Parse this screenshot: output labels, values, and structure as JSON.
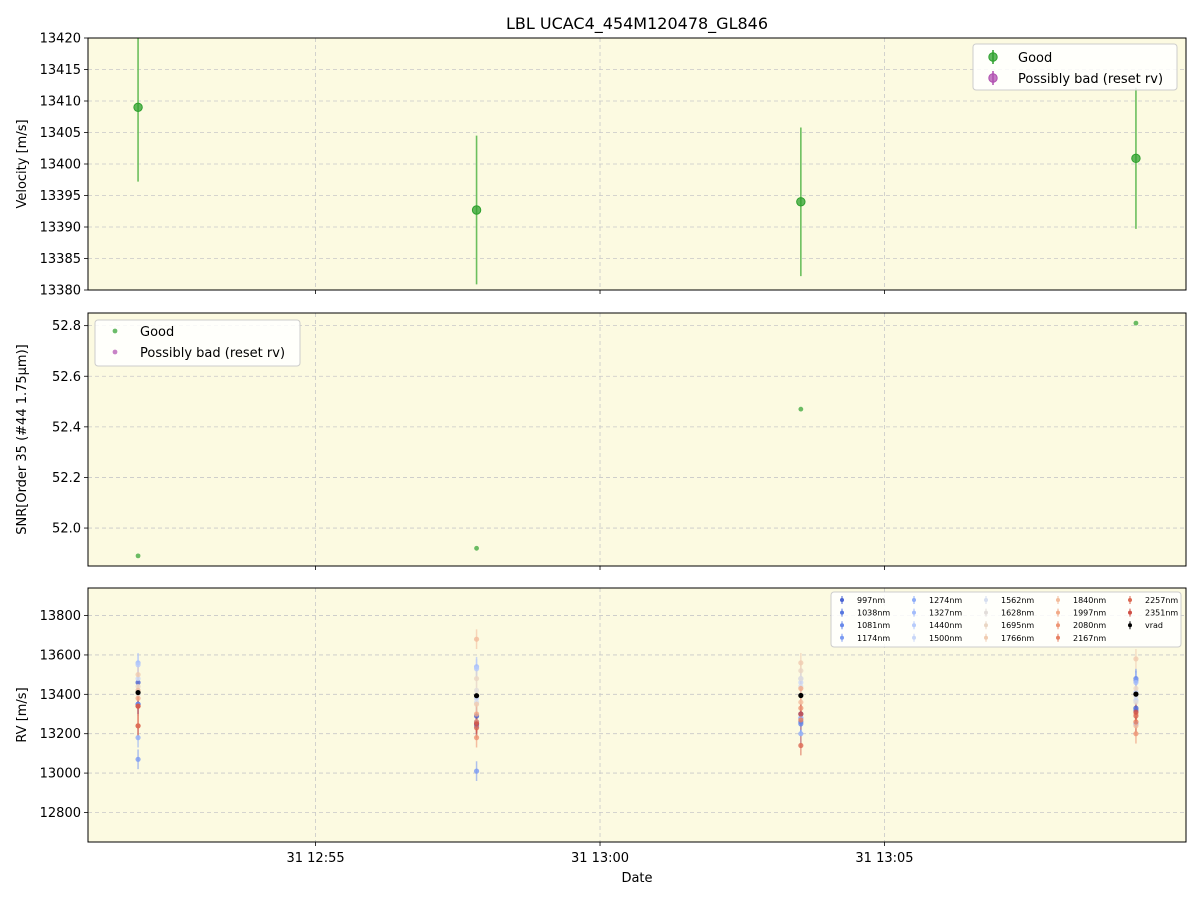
{
  "title": "LBL UCAC4_454M120478_GL846",
  "xlabel": "Date",
  "x_ticks": [
    "31 12:55",
    "31 13:00",
    "31 13:05"
  ],
  "x_tick_minutes": [
    55,
    60,
    65
  ],
  "x_range_minutes": [
    51.0,
    70.3
  ],
  "colors": {
    "plot_bg": "#fcfae1",
    "good": "#2ca02c",
    "good_err": "#6cbf5e",
    "bad": "#b04fb0",
    "grid": "#c8c8c8",
    "vrad": "#000000"
  },
  "chart_data": [
    {
      "type": "scatter",
      "ylabel": "Velocity [m/s]",
      "ylim": [
        13380,
        13420
      ],
      "y_ticks": [
        13380,
        13385,
        13390,
        13395,
        13400,
        13405,
        13410,
        13415,
        13420
      ],
      "legend": [
        "Good",
        "Possibly bad (reset rv)"
      ],
      "legend_loc": "upper right",
      "grid": true,
      "series": [
        {
          "name": "Good",
          "x_minutes": [
            51.88,
            57.83,
            63.53,
            69.42
          ],
          "y": [
            13409.0,
            13392.7,
            13394.0,
            13400.9
          ],
          "yerr": [
            11.8,
            11.8,
            11.8,
            11.2
          ]
        },
        {
          "name": "Possibly bad (reset rv)",
          "x_minutes": [],
          "y": [],
          "yerr": []
        }
      ]
    },
    {
      "type": "scatter",
      "ylabel": "SNR[Order 35 (#44 1.75μm)]",
      "ylim": [
        51.85,
        52.85
      ],
      "y_ticks": [
        52.0,
        52.2,
        52.4,
        52.6,
        52.8
      ],
      "y_tick_labels": [
        "52.0",
        "52.2",
        "52.4",
        "52.6",
        "52.8"
      ],
      "legend": [
        "Good",
        "Possibly bad (reset rv)"
      ],
      "legend_loc": "upper left",
      "grid": true,
      "series": [
        {
          "name": "Good",
          "x_minutes": [
            51.88,
            57.83,
            63.53,
            69.42
          ],
          "y": [
            51.89,
            51.92,
            52.47,
            52.81
          ]
        },
        {
          "name": "Possibly bad (reset rv)",
          "x_minutes": [],
          "y": []
        }
      ]
    },
    {
      "type": "scatter",
      "ylabel": "RV [m/s]",
      "ylim": [
        12650,
        13940
      ],
      "y_ticks": [
        12800,
        13000,
        13200,
        13400,
        13600,
        13800
      ],
      "legend_loc": "upper right",
      "legend_columns": 5,
      "grid": true,
      "x_minutes": [
        51.88,
        57.83,
        63.53,
        69.42
      ],
      "series": [
        {
          "name": "997nm",
          "color": "#4a63d3",
          "y": [
            13460,
            13290,
            13300,
            13330
          ]
        },
        {
          "name": "1038nm",
          "color": "#5677e0",
          "y": [
            13350,
            13250,
            13260,
            13320
          ]
        },
        {
          "name": "1081nm",
          "color": "#6788ea",
          "y": [
            13350,
            13240,
            13250,
            13480
          ]
        },
        {
          "name": "1174nm",
          "color": "#7a9af2",
          "y": [
            13070,
            13010,
            13280,
            13470
          ]
        },
        {
          "name": "1274nm",
          "color": "#8eacf8",
          "y": [
            13180,
            13260,
            13200,
            13250
          ]
        },
        {
          "name": "1327nm",
          "color": "#a3bcfb",
          "y": [
            13560,
            13540,
            13280,
            13460
          ]
        },
        {
          "name": "1440nm",
          "color": "#b7cbfb",
          "y": [
            13550,
            13530,
            13480,
            13410
          ]
        },
        {
          "name": "1500nm",
          "color": "#c8d6f8",
          "y": [
            13480,
            13380,
            13460,
            13370
          ]
        },
        {
          "name": "1562nm",
          "color": "#d6deef",
          "y": [
            13420,
            13360,
            13440,
            13390
          ]
        },
        {
          "name": "1628nm",
          "color": "#e2ddda",
          "y": [
            13400,
            13420,
            13480,
            13360
          ]
        },
        {
          "name": "1695nm",
          "color": "#ead6c4",
          "y": [
            13440,
            13480,
            13520,
            13430
          ]
        },
        {
          "name": "1766nm",
          "color": "#f0cbb0",
          "y": [
            13500,
            13350,
            13560,
            13580
          ]
        },
        {
          "name": "1840nm",
          "color": "#f3bc9c",
          "y": [
            13420,
            13680,
            13360,
            13240
          ]
        },
        {
          "name": "1997nm",
          "color": "#f2aa88",
          "y": [
            13380,
            13300,
            13430,
            13300
          ]
        },
        {
          "name": "2080nm",
          "color": "#ee9574",
          "y": [
            13340,
            13180,
            13330,
            13200
          ]
        },
        {
          "name": "2167nm",
          "color": "#e77f62",
          "y": [
            13240,
            13260,
            13270,
            13260
          ]
        },
        {
          "name": "2257nm",
          "color": "#dc6852",
          "y": [
            13240,
            13230,
            13140,
            13290
          ]
        },
        {
          "name": "2351nm",
          "color": "#cf4e44",
          "y": [
            13340,
            13250,
            13300,
            13310
          ]
        },
        {
          "name": "vrad",
          "color": "#000000",
          "y": [
            13409,
            13393,
            13394,
            13401
          ]
        }
      ]
    }
  ]
}
